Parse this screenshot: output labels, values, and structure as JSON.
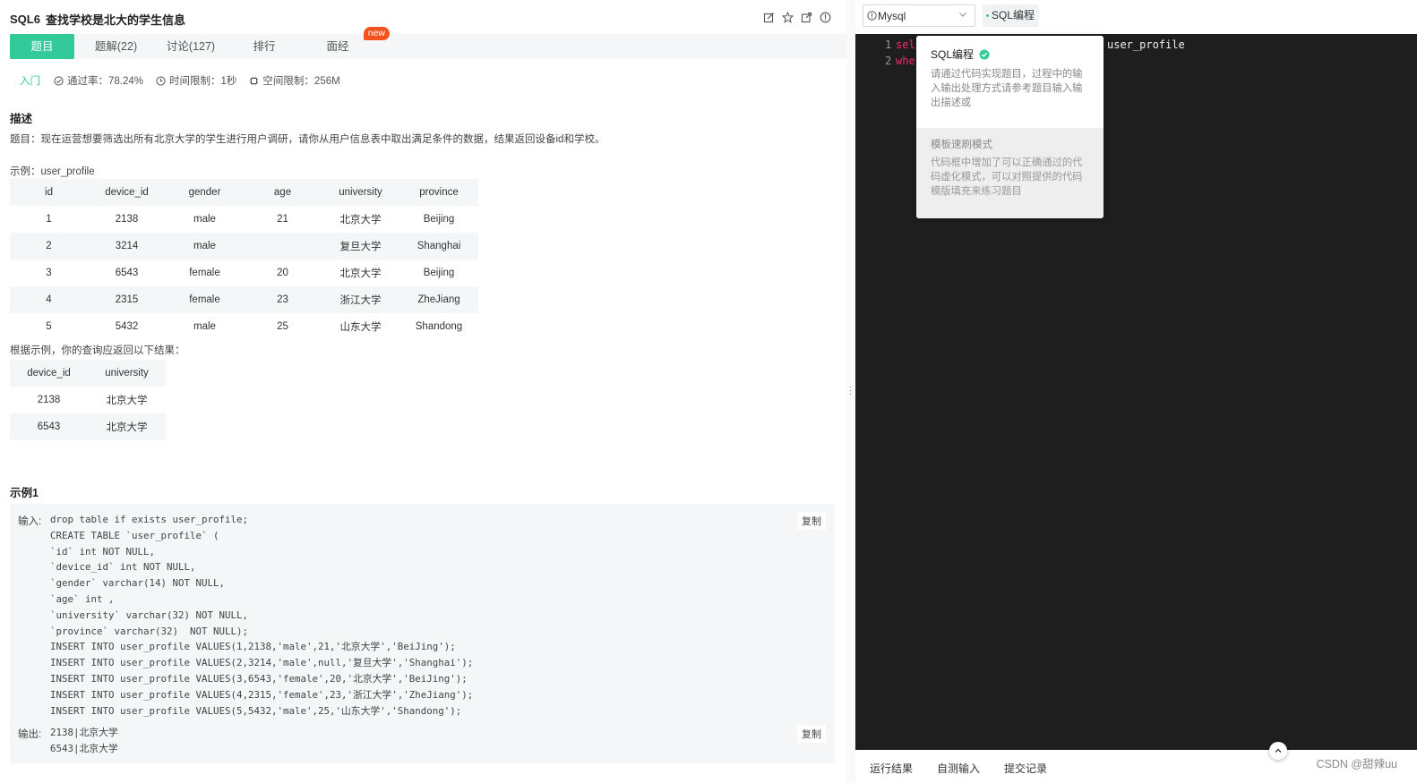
{
  "problem": {
    "code": "SQL6",
    "title": "查找学校是北大的学生信息"
  },
  "header_icons": [
    "edit-icon",
    "star-icon",
    "share-icon",
    "info-icon"
  ],
  "tabs": [
    {
      "label": "题目",
      "active": true
    },
    {
      "label": "题解(22)",
      "active": false
    },
    {
      "label": "讨论(127)",
      "active": false
    },
    {
      "label": "排行",
      "active": false
    },
    {
      "label": "面经",
      "active": false,
      "badge": "new"
    }
  ],
  "meta": {
    "level": "入门",
    "pass_rate": "通过率：78.24%",
    "time_limit": "时间限制：1秒",
    "space_limit": "空间限制：256M"
  },
  "description": {
    "heading": "描述",
    "text": "题目：现在运营想要筛选出所有北京大学的学生进行用户调研，请你从用户信息表中取出满足条件的数据，结果返回设备id和学校。",
    "example_label": "示例：user_profile"
  },
  "table1": {
    "columns": [
      "id",
      "device_id",
      "gender",
      "age",
      "university",
      "province"
    ],
    "rows": [
      [
        "1",
        "2138",
        "male",
        "21",
        "北京大学",
        "Beijing"
      ],
      [
        "2",
        "3214",
        "male",
        "",
        "复旦大学",
        "Shanghai"
      ],
      [
        "3",
        "6543",
        "female",
        "20",
        "北京大学",
        "Beijing"
      ],
      [
        "4",
        "2315",
        "female",
        "23",
        "浙江大学",
        "ZheJiang"
      ],
      [
        "5",
        "5432",
        "male",
        "25",
        "山东大学",
        "Shandong"
      ]
    ]
  },
  "result_label": "根据示例，你的查询应返回以下结果：",
  "table2": {
    "columns": [
      "device_id",
      "university"
    ],
    "rows": [
      [
        "2138",
        "北京大学"
      ],
      [
        "6543",
        "北京大学"
      ]
    ]
  },
  "example1": {
    "heading": "示例1",
    "input_label": "输入:",
    "output_label": "输出:",
    "copy_label": "复制",
    "input_lines": [
      "drop table if exists user_profile;",
      "CREATE TABLE `user_profile` (",
      "`id` int NOT NULL,",
      "`device_id` int NOT NULL,",
      "`gender` varchar(14) NOT NULL,",
      "`age` int ,",
      "`university` varchar(32) NOT NULL,",
      "`province` varchar(32)  NOT NULL);",
      "INSERT INTO user_profile VALUES(1,2138,'male',21,'北京大学','BeiJing');",
      "INSERT INTO user_profile VALUES(2,3214,'male',null,'复旦大学','Shanghai');",
      "INSERT INTO user_profile VALUES(3,6543,'female',20,'北京大学','BeiJing');",
      "INSERT INTO user_profile VALUES(4,2315,'female',23,'浙江大学','ZheJiang');",
      "INSERT INTO user_profile VALUES(5,5432,'male',25,'山东大学','Shandong');"
    ],
    "output_lines": [
      "2138|北京大学",
      "6543|北京大学"
    ]
  },
  "editor": {
    "language": "Mysql",
    "mode": "SQL编程",
    "lines": [
      {
        "num": "1",
        "kw": "sel",
        "rest": "user_profile"
      },
      {
        "num": "2",
        "kw": "whe",
        "rest": ""
      }
    ]
  },
  "popover": {
    "option1_title": "SQL编程",
    "option1_desc": "请通过代码实现题目，过程中的输入输出处理方式请参考题目输入输出描述或",
    "option2_title": "模板速刷模式",
    "option2_desc": "代码框中增加了可以正确通过的代码虚化模式，可以对照提供的代码模版填充来练习题目"
  },
  "bottom_tabs": [
    "运行结果",
    "自测输入",
    "提交记录"
  ],
  "watermark": "CSDN @甜辣uu",
  "colors": {
    "accent": "#32ca99",
    "badge": "#f4511e",
    "editor_bg": "#1e1e1e",
    "keyword": "#f92672"
  }
}
